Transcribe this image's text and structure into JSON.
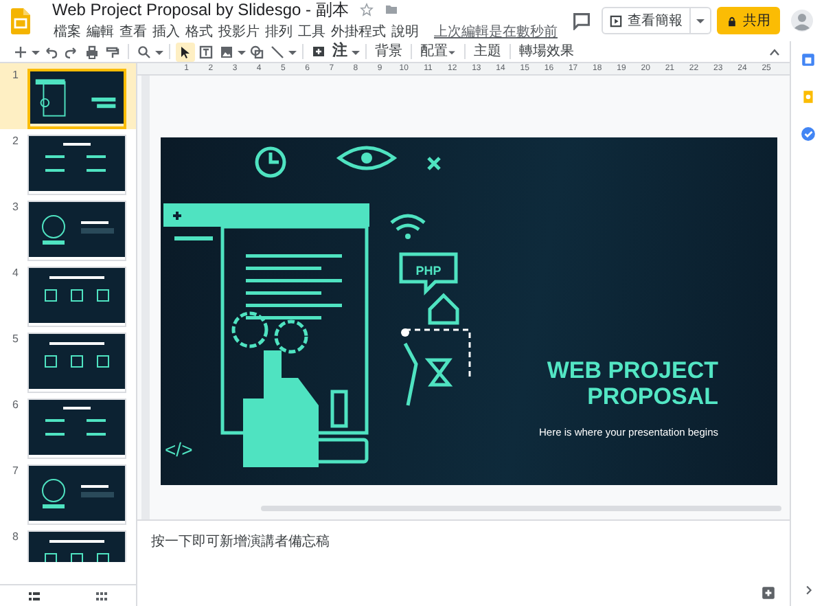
{
  "document": {
    "title": "Web Project Proposal by Slidesgo - 副本",
    "last_edit": "上次編輯是在數秒前"
  },
  "menu": [
    "檔案",
    "編輯",
    "查看",
    "插入",
    "格式",
    "投影片",
    "排列",
    "工具",
    "外掛程式",
    "說明"
  ],
  "header_buttons": {
    "present": "查看簡報",
    "share": "共用"
  },
  "toolbar": {
    "pointer_selected": true,
    "input_tool": "注",
    "text_buttons": [
      {
        "label": "背景",
        "dropdown": false
      },
      {
        "label": "配置",
        "dropdown": true
      },
      {
        "label": "主題",
        "dropdown": false
      },
      {
        "label": "轉場效果",
        "dropdown": false
      }
    ]
  },
  "ruler": {
    "marks": [
      "1",
      "2",
      "3",
      "4",
      "5",
      "6",
      "7",
      "8",
      "9",
      "10",
      "11",
      "12",
      "13",
      "14",
      "15",
      "16",
      "17",
      "18",
      "19",
      "20",
      "21",
      "22",
      "23",
      "24",
      "25"
    ]
  },
  "slides": [
    {
      "number": "1",
      "selected": true
    },
    {
      "number": "2",
      "selected": false
    },
    {
      "number": "3",
      "selected": false
    },
    {
      "number": "4",
      "selected": false
    },
    {
      "number": "5",
      "selected": false
    },
    {
      "number": "6",
      "selected": false
    },
    {
      "number": "7",
      "selected": false
    },
    {
      "number": "8",
      "selected": false
    }
  ],
  "slide": {
    "title": "WEB PROJECT\nPROPOSAL",
    "subtitle": "Here is where your presentation begins",
    "illustration_labels": [
      "PHP",
      "</>"
    ]
  },
  "notes": {
    "placeholder": "按一下即可新增演講者備忘稿"
  }
}
